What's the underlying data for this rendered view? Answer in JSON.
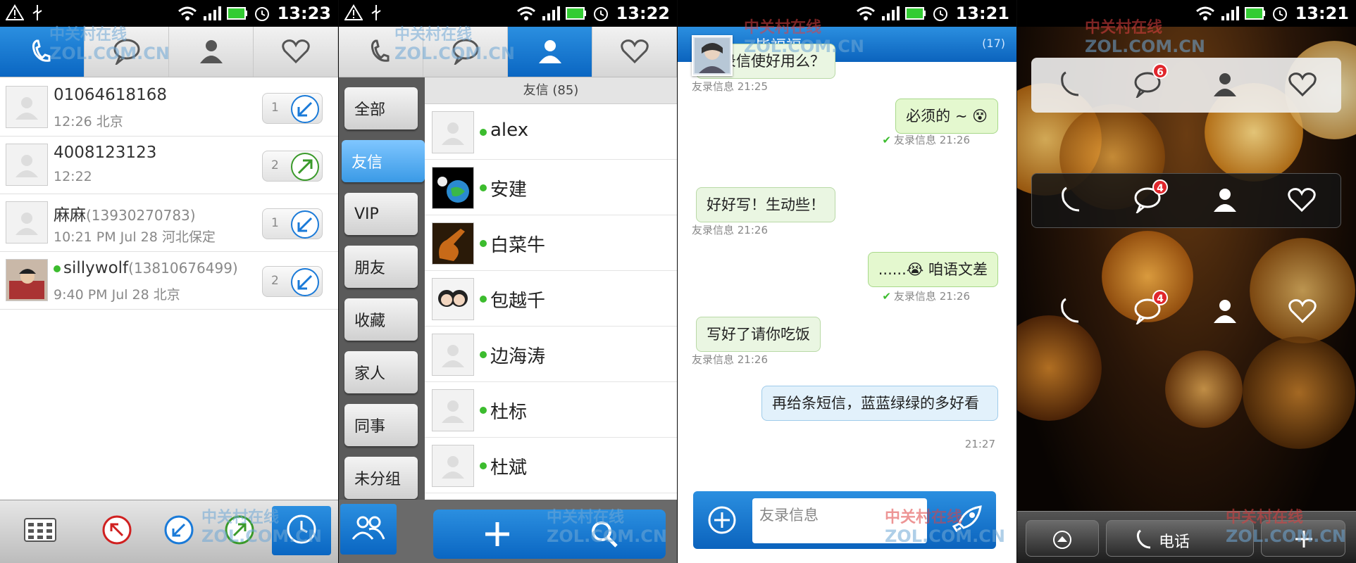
{
  "status": {
    "time_p1": "13:23",
    "time_p2": "13:22",
    "time_p3": "13:21",
    "time_p4": "13:21"
  },
  "watermark": "中关村在线 ZOL.COM.CN",
  "call_log": {
    "rows": [
      {
        "name": "01064618168",
        "number": "",
        "sub": "12:26 北京",
        "count": "1",
        "direction": "incoming",
        "online": false
      },
      {
        "name": "4008123123",
        "number": "",
        "sub": "12:22",
        "count": "2",
        "direction": "outgoing",
        "online": false
      },
      {
        "name": "麻麻",
        "number": "(13930270783)",
        "sub": "10:21 PM Jul 28 河北保定",
        "count": "1",
        "direction": "incoming",
        "online": false
      },
      {
        "name": "sillywolf",
        "number": "(13810676499)",
        "sub": "9:40 PM Jul 28 北京",
        "count": "2",
        "direction": "incoming",
        "online": true
      }
    ]
  },
  "contacts": {
    "header": "友信 (85)",
    "groups": [
      "全部",
      "友信",
      "VIP",
      "朋友",
      "收藏",
      "家人",
      "同事",
      "未分组"
    ],
    "active_group": 1,
    "list": [
      {
        "name": "alex"
      },
      {
        "name": "安建"
      },
      {
        "name": "白菜牛"
      },
      {
        "name": "包越千"
      },
      {
        "name": "边海涛"
      },
      {
        "name": "杜标"
      },
      {
        "name": "杜斌"
      }
    ]
  },
  "chat": {
    "contact_name": "毕福福",
    "count": "(17)",
    "messages": [
      {
        "text": "友录信使好用么？",
        "side": "in",
        "meta": "友录信息  21:25"
      },
      {
        "text": "必须的 ~ 😵",
        "side": "out",
        "meta": "友录信息  21:26"
      },
      {
        "text": "好好写！生动些！",
        "side": "in",
        "meta": "友录信息  21:26"
      },
      {
        "text": "......😭 咱语文差",
        "side": "out",
        "meta": "友录信息  21:26"
      },
      {
        "text": "写好了请你吃饭",
        "side": "in",
        "meta": "友录信息  21:26"
      },
      {
        "text": "再给条短信，蓝蓝绿绿的多好看",
        "side": "sending",
        "meta": "21:27"
      }
    ],
    "input_placeholder": "友录信息"
  },
  "home": {
    "widget1_badge": "6",
    "widget2_badge": "4",
    "widget3_badge": "4",
    "dock_phone_label": "电话"
  }
}
